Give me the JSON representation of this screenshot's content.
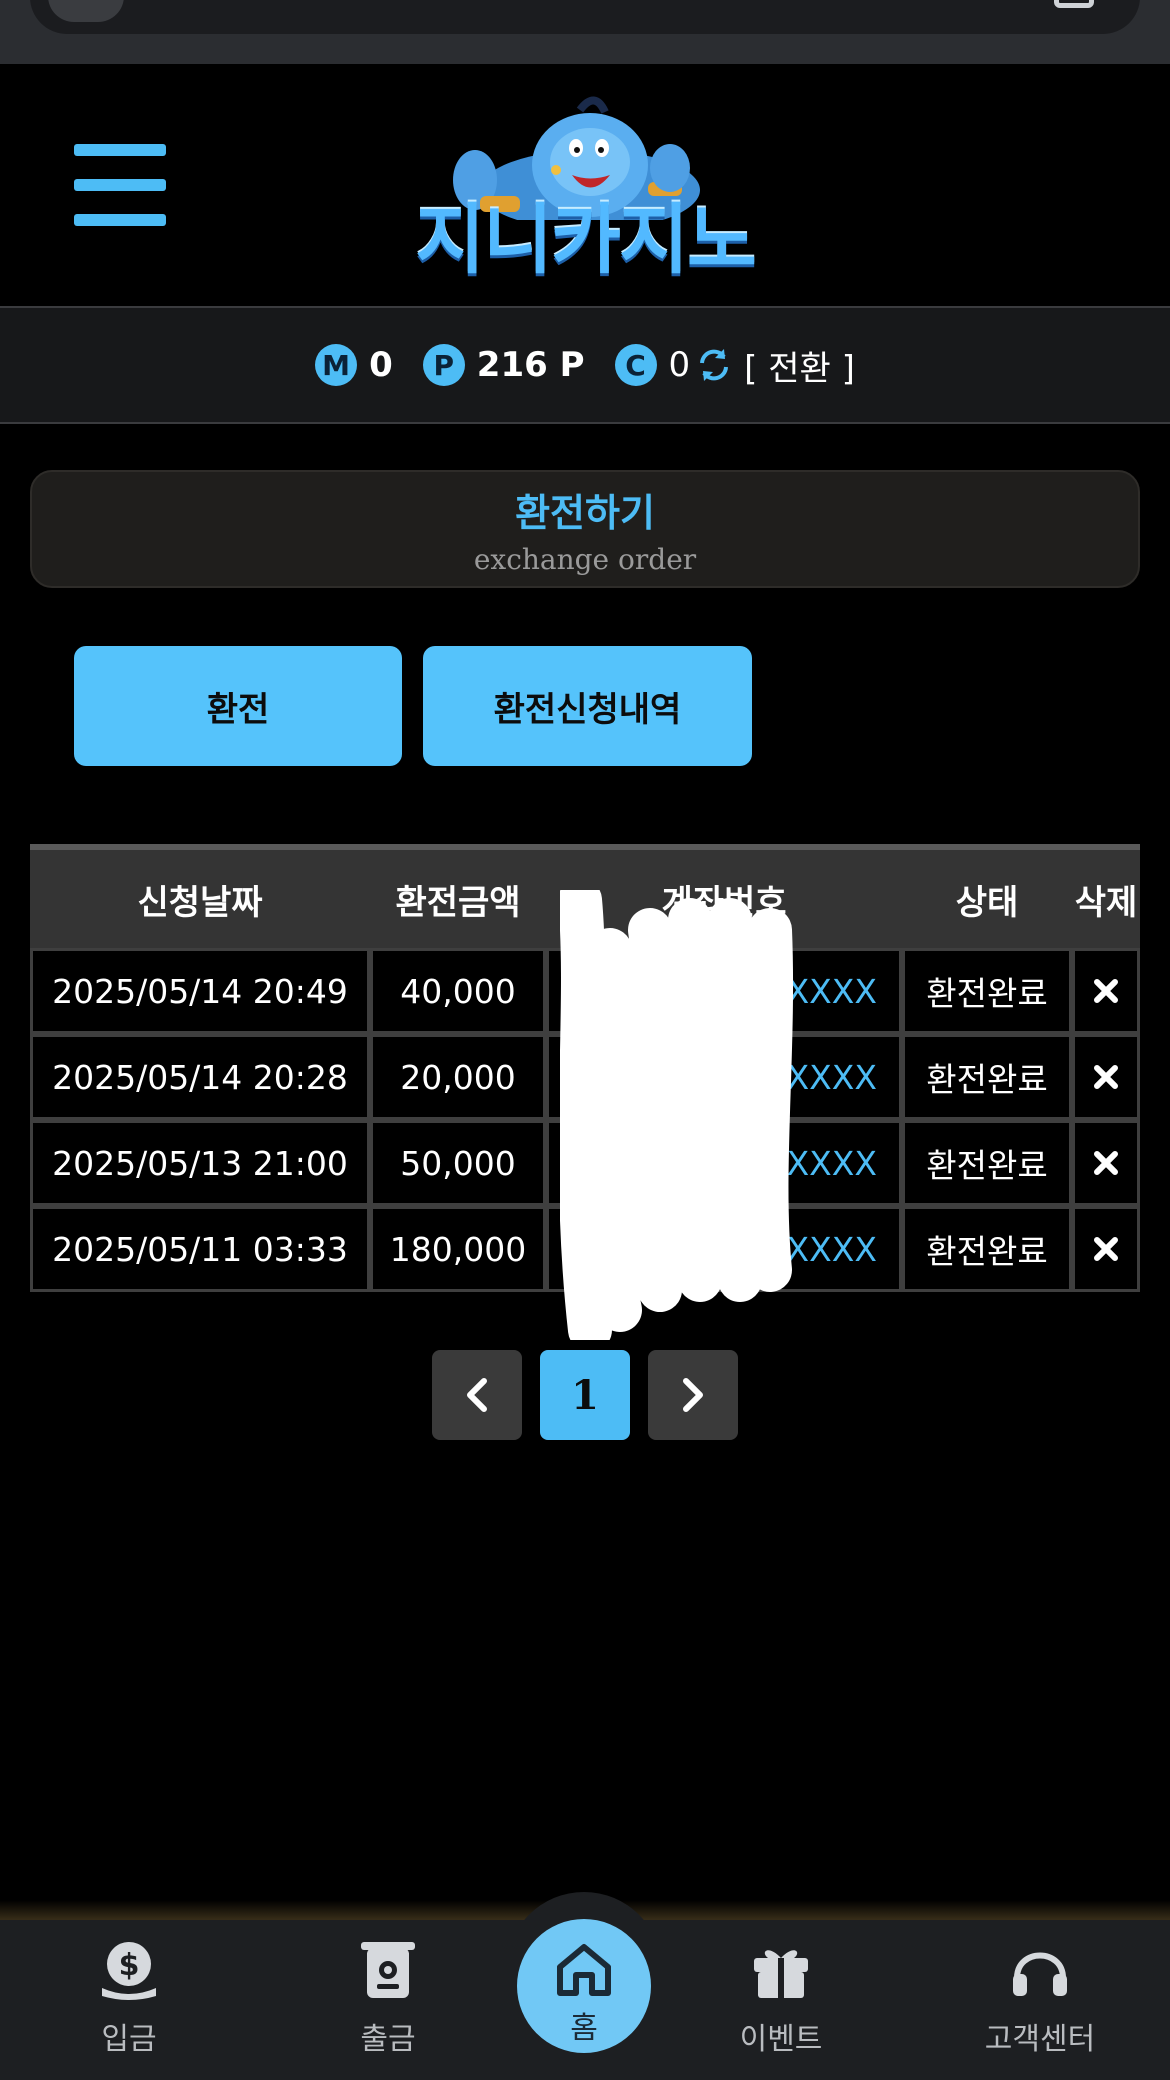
{
  "header": {
    "logo_text": "지니카지노"
  },
  "balances": {
    "money": {
      "badge": "M",
      "value": "0"
    },
    "point": {
      "badge": "P",
      "value": "216 P"
    },
    "casino": {
      "badge": "C",
      "value": "0"
    },
    "convert_label": "[ 전환 ]"
  },
  "title": {
    "main": "환전하기",
    "sub": "exchange order"
  },
  "tabs": {
    "exchange": "환전",
    "history": "환전신청내역"
  },
  "table": {
    "headers": [
      "신청날짜",
      "환전금액",
      "계좌번호",
      "상태",
      "삭제"
    ],
    "rows": [
      {
        "date": "2025/05/14 20:49",
        "amount": "40,000",
        "account": "XXXX",
        "status": "환전완료"
      },
      {
        "date": "2025/05/14 20:28",
        "amount": "20,000",
        "account": "XXXX",
        "status": "환전완료"
      },
      {
        "date": "2025/05/13 21:00",
        "amount": "50,000",
        "account": "XXXX",
        "status": "환전완료"
      },
      {
        "date": "2025/05/11 03:33",
        "amount": "180,000",
        "account": "XXXXX",
        "status": "환전완료"
      }
    ]
  },
  "pagination": {
    "current": "1"
  },
  "bottom_nav": {
    "deposit": "입금",
    "withdraw": "출금",
    "home": "홈",
    "event": "이벤트",
    "support": "고객센터"
  },
  "colors": {
    "accent": "#4dbcf5",
    "background": "#000000",
    "nav_bg": "#1d1f22"
  }
}
